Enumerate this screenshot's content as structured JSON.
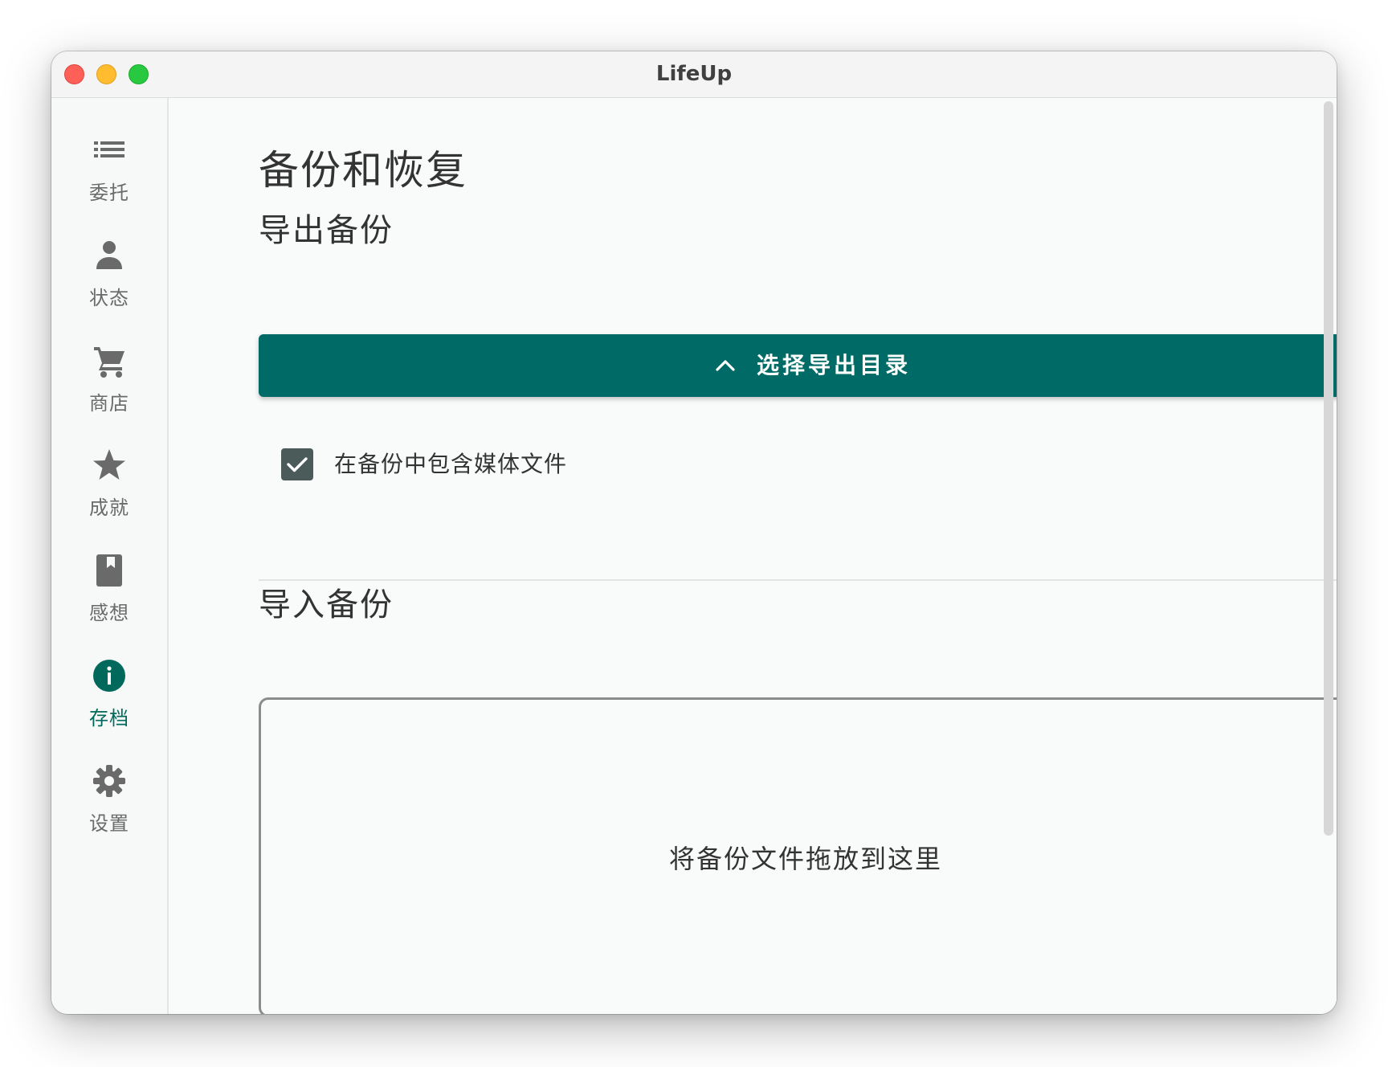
{
  "window": {
    "title": "LifeUp"
  },
  "sidebar": {
    "items": [
      {
        "label": "委托",
        "icon": "list-icon",
        "active": false
      },
      {
        "label": "状态",
        "icon": "person-icon",
        "active": false
      },
      {
        "label": "商店",
        "icon": "cart-icon",
        "active": false
      },
      {
        "label": "成就",
        "icon": "star-icon",
        "active": false
      },
      {
        "label": "感想",
        "icon": "bookmark-book-icon",
        "active": false
      },
      {
        "label": "存档",
        "icon": "info-icon",
        "active": true
      },
      {
        "label": "设置",
        "icon": "gear-icon",
        "active": false
      }
    ]
  },
  "main": {
    "page_title": "备份和恢复",
    "export": {
      "section_title": "导出备份",
      "button_label": "选择导出目录",
      "include_media_label": "在备份中包含媒体文件",
      "include_media_checked": true
    },
    "import": {
      "section_title": "导入备份",
      "dropzone_text": "将备份文件拖放到这里"
    }
  },
  "colors": {
    "accent": "#006b66",
    "active_nav": "#00695c",
    "icon_gray": "#6a6a6a",
    "checkbox": "#4a5b5a"
  }
}
